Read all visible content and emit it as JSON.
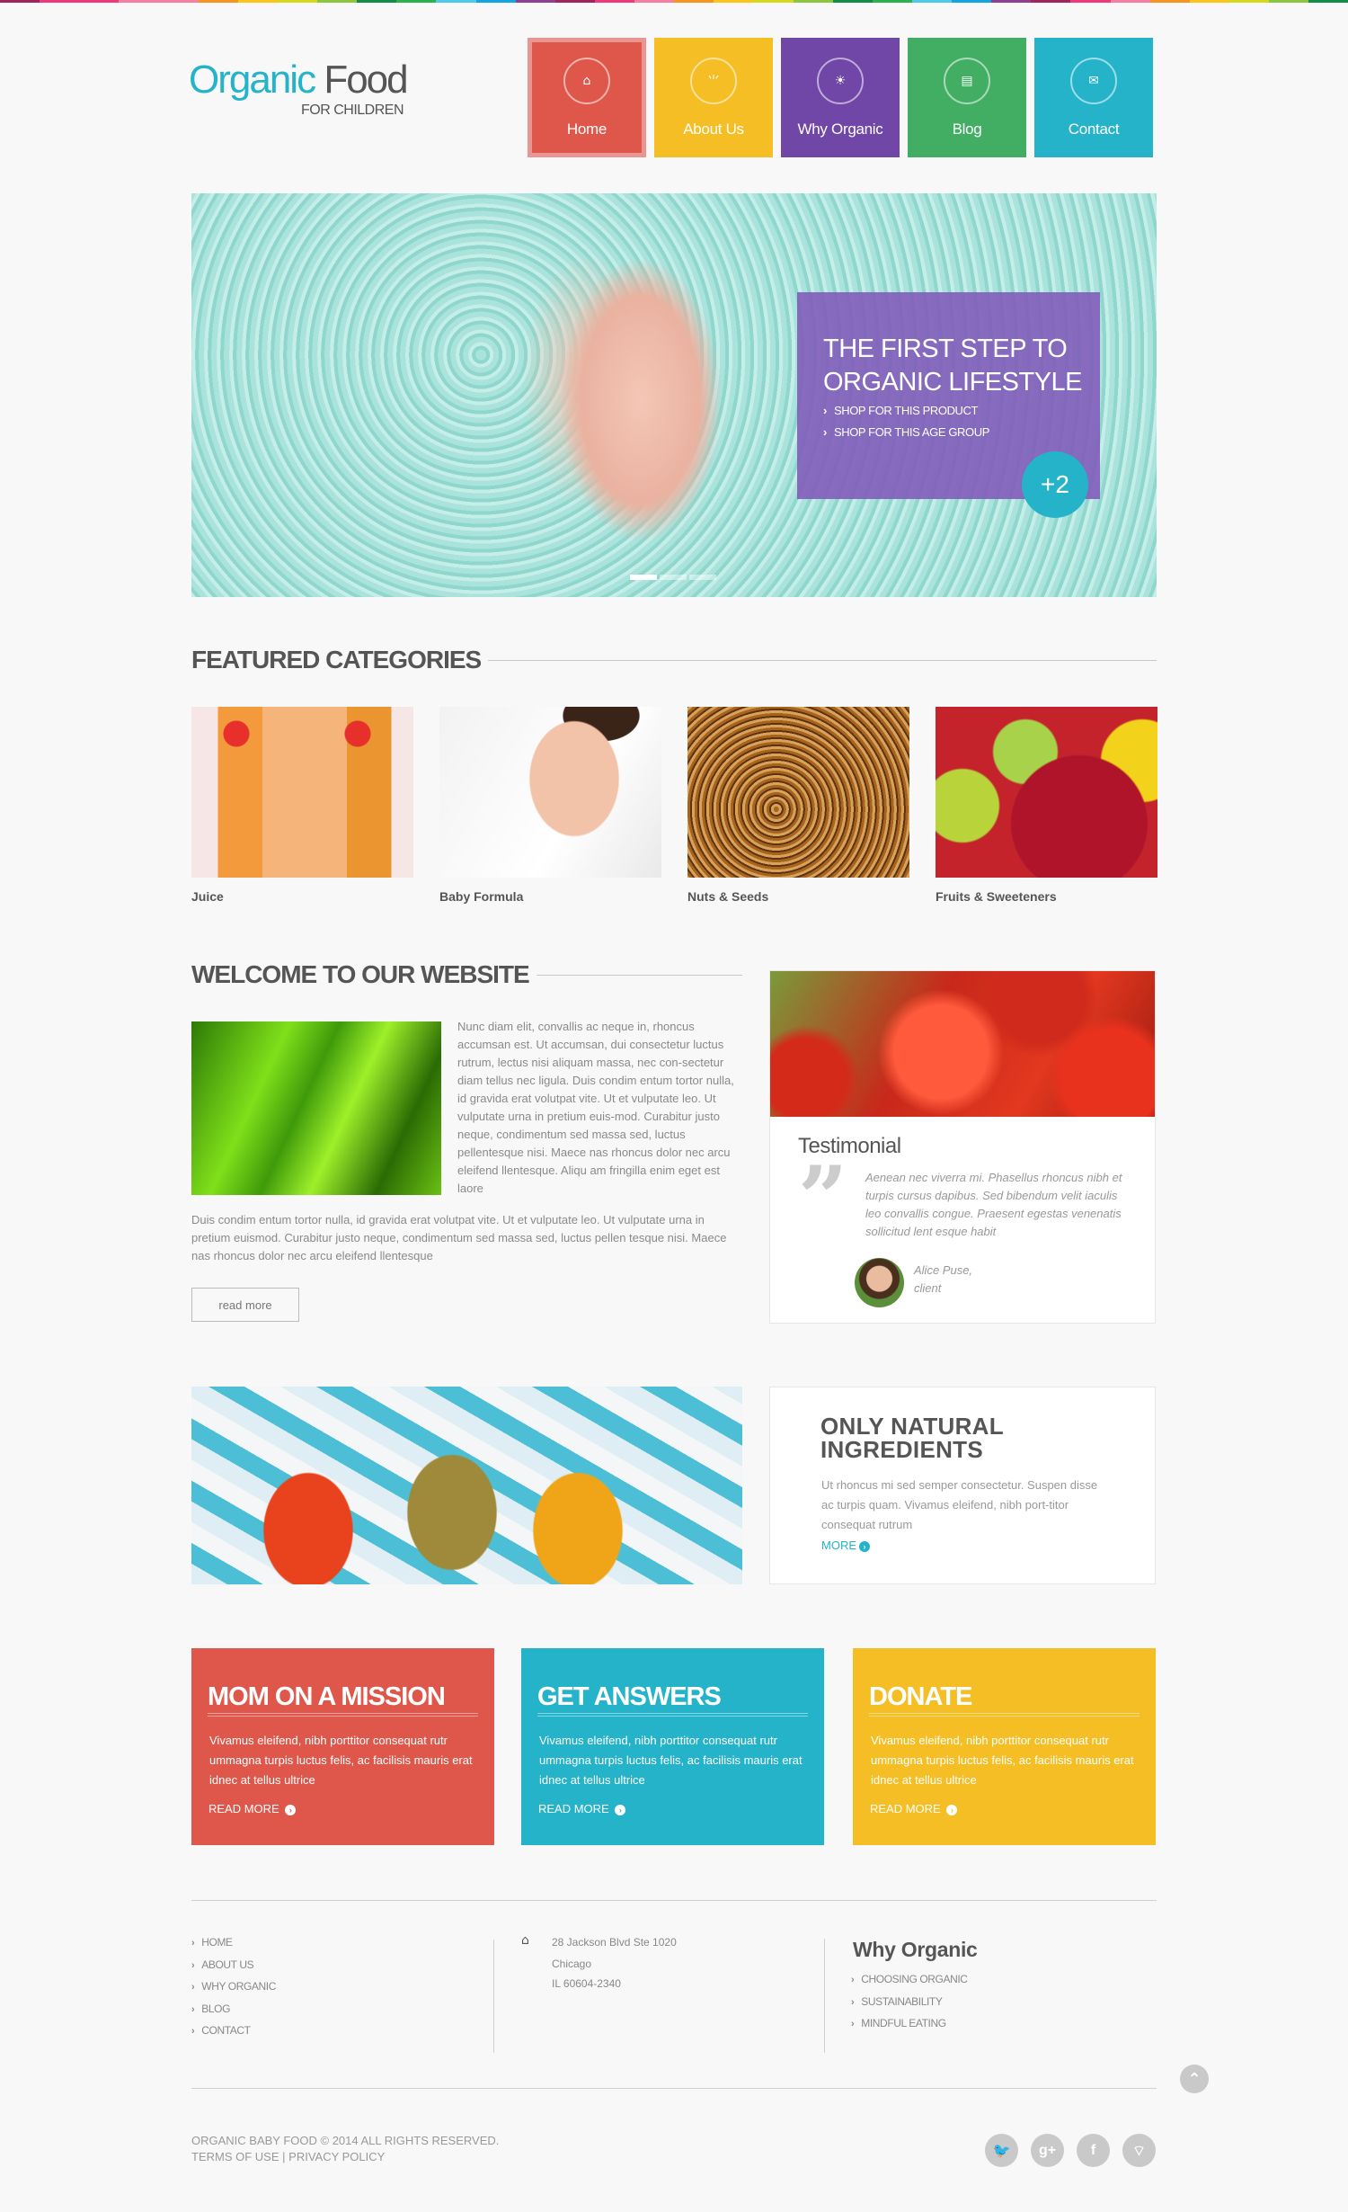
{
  "rainbow_colors": [
    "#a0245c",
    "#f0397a",
    "#f0397a",
    "#f57fa0",
    "#f57fa0",
    "#f7941d",
    "#fbc51c",
    "#d7d71c",
    "#8cc63f",
    "#0e8c48",
    "#2bb24c",
    "#4fc9eb",
    "#12a4de",
    "#8e3d93",
    "#a0245c",
    "#f0397a",
    "#f57fa0",
    "#f7941d",
    "#fbc51c",
    "#d7d71c",
    "#8cc63f",
    "#0e8c48",
    "#2bb24c",
    "#4fc9eb",
    "#12a4de",
    "#8e3d93",
    "#a0245c",
    "#f0397a",
    "#f57fa0",
    "#f7941d",
    "#fbc51c",
    "#d7d71c",
    "#8cc63f",
    "#0e8c48"
  ],
  "logo": {
    "word1": "Organic",
    "word2": "Food",
    "tagline": "FOR CHILDREN"
  },
  "nav": [
    {
      "label": "Home",
      "icon": "home-icon",
      "glyph": "⌂",
      "color": "#df574a",
      "active": true
    },
    {
      "label": "About Us",
      "icon": "grass-icon",
      "glyph": "⺌",
      "color": "#f5be25",
      "active": false
    },
    {
      "label": "Why Organic",
      "icon": "sun-icon",
      "glyph": "☀",
      "color": "#7046a6",
      "active": false
    },
    {
      "label": "Blog",
      "icon": "notebook-icon",
      "glyph": "▤",
      "color": "#41ae63",
      "active": false
    },
    {
      "label": "Contact",
      "icon": "envelope-icon",
      "glyph": "✉",
      "color": "#24b3c9",
      "active": false
    }
  ],
  "hero": {
    "title_line1": "THE FIRST STEP TO",
    "title_line2": "ORGANIC LIFESTYLE",
    "links": [
      "SHOP FOR THIS PRODUCT",
      "SHOP FOR THIS AGE GROUP"
    ],
    "badge": "+2",
    "slides_total": 3,
    "slide_active": 1
  },
  "featured": {
    "title": "FEATURED CATEGORIES",
    "items": [
      {
        "label": "Juice"
      },
      {
        "label": "Baby Formula"
      },
      {
        "label": "Nuts & Seeds"
      },
      {
        "label": "Fruits & Sweeteners"
      }
    ]
  },
  "welcome": {
    "title": "WELCOME TO OUR WEBSITE",
    "para1": "Nunc diam elit, convallis ac neque in, rhoncus accumsan est. Ut accumsan, dui consectetur luctus rutrum, lectus nisi aliquam massa, nec con-sectetur diam tellus nec ligula. Duis condim entum tortor nulla, id gravida erat volutpat vite. Ut et vulputate leo. Ut vulputate urna in pretium euis-mod. Curabitur justo neque, condimentum sed massa sed, luctus pellentesque nisi. Maece nas rhoncus dolor nec arcu eleifend llentesque. Aliqu am fringilla enim eget est laore",
    "para2": "Duis condim entum tortor nulla, id gravida erat volutpat vite. Ut et vulputate leo. Ut vulputate urna in pretium euismod. Curabitur justo neque, condimentum sed massa sed, luctus pellen tesque nisi. Maece nas rhoncus dolor nec arcu eleifend llentesque",
    "read_more": "read more"
  },
  "testimonial": {
    "title": "Testimonial",
    "quote": "Aenean nec viverra mi. Phasellus rhoncus nibh et turpis cursus dapibus. Sed bibendum velit iaculis leo convallis congue. Praesent egestas venenatis sollicitud lent esque habit",
    "name": "Alice Puse,",
    "role": "client"
  },
  "natural": {
    "title_line1": "ONLY NATURAL",
    "title_line2": "INGREDIENTS",
    "text": "Ut rhoncus mi sed semper consectetur. Suspen disse ac turpis quam. Vivamus eleifend, nibh port-titor consequat rutrum",
    "more": "MORE"
  },
  "boxes": [
    {
      "title": "MOM ON A MISSION",
      "text": "Vivamus eleifend, nibh porttitor consequat rutr ummagna turpis luctus felis, ac facilisis mauris erat idnec at tellus ultrice",
      "more": "READ MORE",
      "color": "#df574a"
    },
    {
      "title": "GET ANSWERS",
      "text": "Vivamus eleifend, nibh porttitor consequat rutr ummagna turpis luctus felis, ac facilisis mauris erat idnec at tellus ultrice",
      "more": "READ MORE",
      "color": "#24b3c9"
    },
    {
      "title": "DONATE",
      "text": "Vivamus eleifend, nibh porttitor consequat rutr ummagna turpis luctus felis, ac facilisis mauris erat idnec at tellus ultrice",
      "more": "READ MORE",
      "color": "#f5be25"
    }
  ],
  "footer": {
    "links": [
      "HOME",
      "ABOUT US",
      "WHY ORGANIC",
      "BLOG",
      "CONTACT"
    ],
    "address": [
      "28 Jackson Blvd Ste 1020",
      "Chicago",
      "IL 60604-2340"
    ],
    "why_title": "Why Organic",
    "why_links": [
      "CHOOSING ORGANIC",
      "SUSTAINABILITY",
      "MINDFUL EATING"
    ],
    "copyright": "ORGANIC BABY FOOD © 2014 ALL RIGHTS RESERVED.",
    "terms": "TERMS OF USE",
    "separator": "|",
    "privacy": "PRIVACY POLICY",
    "socials": [
      {
        "name": "twitter-icon",
        "glyph": "🐦"
      },
      {
        "name": "google-plus-icon",
        "glyph": "g+"
      },
      {
        "name": "facebook-icon",
        "glyph": "f"
      },
      {
        "name": "rss-icon",
        "glyph": "⌔"
      }
    ],
    "back_to_top": "⌃"
  }
}
